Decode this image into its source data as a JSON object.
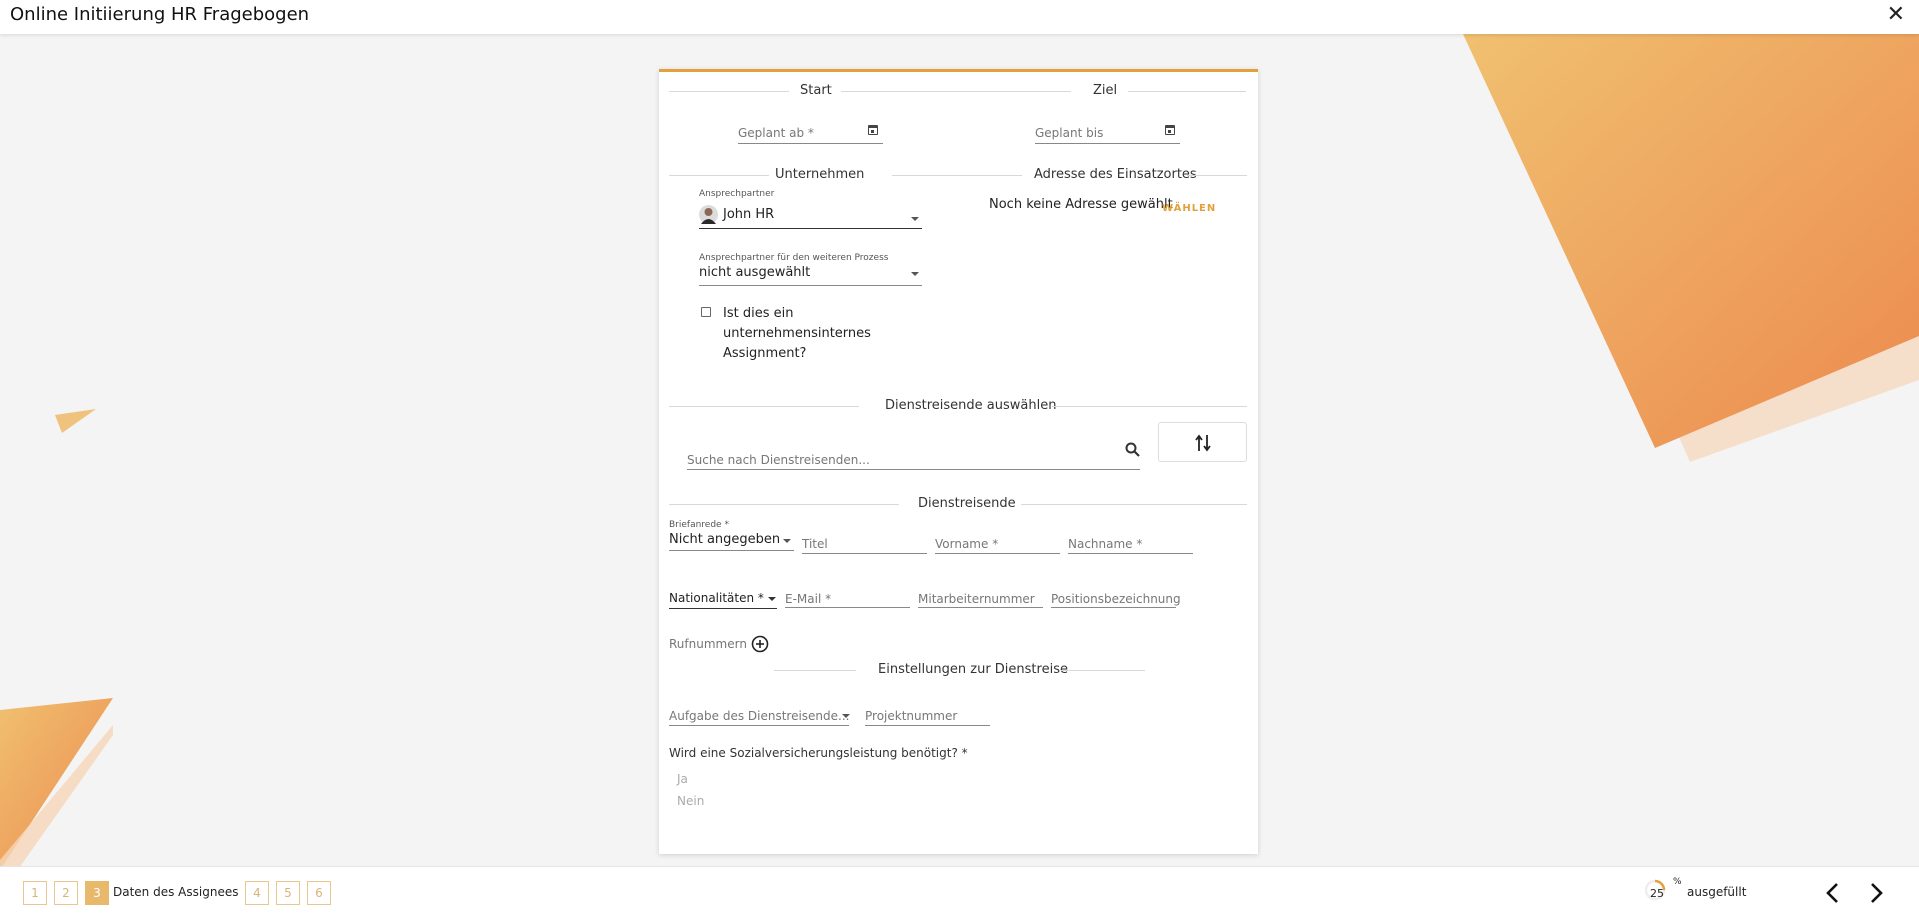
{
  "window": {
    "title": "Online Initiierung HR Fragebogen"
  },
  "icons": {
    "close": "close-icon",
    "calendar": "calendar-icon",
    "search": "search-icon",
    "swap": "swap-vertical-icon",
    "add": "add-circle-icon",
    "progress": "progress-ring-icon",
    "prev": "chevron-left-icon",
    "next": "chevron-right-icon"
  },
  "colors": {
    "accent": "#e2a13c",
    "step_active": "#e9b96b",
    "link": "#e2a13c"
  },
  "form": {
    "start": {
      "title": "Start",
      "planned_from": {
        "placeholder": "Geplant ab *",
        "value": ""
      }
    },
    "ziel": {
      "title": "Ziel",
      "planned_to": {
        "placeholder": "Geplant bis",
        "value": ""
      }
    },
    "company": {
      "title": "Unternehmen",
      "contact_label": "Ansprechpartner",
      "contact_value": "John HR",
      "contact_further_label": "Ansprechpartner für den weiteren Prozess",
      "contact_further_value": "nicht ausgewählt",
      "internal_checkbox_label_1": "Ist dies ein",
      "internal_checkbox_label_2": "unternehmensinternes",
      "internal_checkbox_label_3": "Assignment?",
      "internal_checked": false
    },
    "location": {
      "title": "Adresse des Einsatzortes",
      "empty_text": "Noch keine Adresse gewählt",
      "choose_label": "WÄHLEN"
    },
    "traveler_select": {
      "title": "Dienstreisende auswählen",
      "search_placeholder": "Suche nach Dienstreisenden..."
    },
    "traveler": {
      "title": "Dienstreisende",
      "salutation_label": "Briefanrede *",
      "salutation_value": "Nicht angegeben",
      "title_field": "Titel",
      "first_name": "Vorname *",
      "last_name": "Nachname *",
      "nationalities": "Nationalitäten *",
      "email": "E-Mail *",
      "employee_number": "Mitarbeiternummer",
      "position": "Positionsbezeichnung",
      "phone_numbers": "Rufnummern"
    },
    "trip_settings": {
      "title": "Einstellungen zur Dienstreise",
      "task": "Aufgabe des Dienstreisende...",
      "project_number": "Projektnummer",
      "social_question": "Wird eine Sozialversicherungsleistung benötigt? *",
      "options": [
        "Ja",
        "Nein"
      ]
    }
  },
  "footer": {
    "steps": [
      "1",
      "2",
      "3",
      "4",
      "5",
      "6"
    ],
    "active_step": "3",
    "active_step_label": "Daten des Assignees",
    "progress_value": "25",
    "progress_unit": "%",
    "progress_text": "ausgefüllt",
    "progress_fraction": 0.25
  }
}
